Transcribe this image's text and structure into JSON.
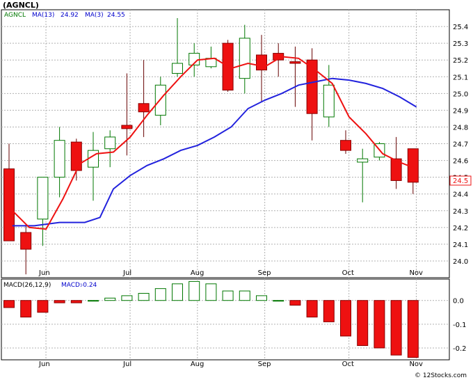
{
  "title": "(AGNCL)",
  "footer": "© 12Stocks.com",
  "colors": {
    "up": "#ffffff",
    "down": "#ee1111",
    "up_border": "#007700",
    "ma13": "#2222dd",
    "ma3": "#ee1111",
    "grid": "#b0b0b0"
  },
  "chart_data": [
    {
      "type": "candlestick",
      "legend": {
        "ticker": "AGNCL",
        "ma13": "MA(13)",
        "ma13_val": "24.92",
        "ma3": "MA(3)",
        "ma3_val": "24.55"
      },
      "ylim": [
        23.9,
        25.5
      ],
      "yticks": [
        "24.0",
        "24.1",
        "24.2",
        "24.3",
        "24.4",
        "24.5",
        "24.6",
        "24.7",
        "24.8",
        "24.9",
        "25.0",
        "25.1",
        "25.2",
        "25.3",
        "25.4"
      ],
      "last_price": "24.5",
      "months": [
        {
          "label": "Jun",
          "at": 1.2
        },
        {
          "label": "Jul",
          "at": 6.2
        },
        {
          "label": "Aug",
          "at": 10.2
        },
        {
          "label": "Sep",
          "at": 14.2
        },
        {
          "label": "Oct",
          "at": 19.2
        },
        {
          "label": "Nov",
          "at": 23.2
        }
      ],
      "candles": [
        {
          "o": 24.55,
          "h": 24.7,
          "l": 24.12,
          "c": 24.12
        },
        {
          "o": 24.17,
          "h": 24.22,
          "l": 23.92,
          "c": 24.07
        },
        {
          "o": 24.25,
          "h": 24.5,
          "l": 24.09,
          "c": 24.5
        },
        {
          "o": 24.5,
          "h": 24.8,
          "l": 24.38,
          "c": 24.72
        },
        {
          "o": 24.71,
          "h": 24.73,
          "l": 24.48,
          "c": 24.54
        },
        {
          "o": 24.56,
          "h": 24.77,
          "l": 24.36,
          "c": 24.66
        },
        {
          "o": 24.67,
          "h": 24.78,
          "l": 24.56,
          "c": 24.74
        },
        {
          "o": 24.81,
          "h": 25.12,
          "l": 24.63,
          "c": 24.79
        },
        {
          "o": 24.94,
          "h": 25.2,
          "l": 24.74,
          "c": 24.89
        },
        {
          "o": 24.87,
          "h": 25.1,
          "l": 24.81,
          "c": 25.05
        },
        {
          "o": 25.12,
          "h": 25.45,
          "l": 25.1,
          "c": 25.18
        },
        {
          "o": 25.17,
          "h": 25.3,
          "l": 25.1,
          "c": 25.24
        },
        {
          "o": 25.16,
          "h": 25.28,
          "l": 25.15,
          "c": 25.21
        },
        {
          "o": 25.3,
          "h": 25.32,
          "l": 25.01,
          "c": 25.02
        },
        {
          "o": 25.09,
          "h": 25.41,
          "l": 25.0,
          "c": 25.33
        },
        {
          "o": 25.23,
          "h": 25.35,
          "l": 24.95,
          "c": 25.14
        },
        {
          "o": 25.24,
          "h": 25.3,
          "l": 25.1,
          "c": 25.2
        },
        {
          "o": 25.19,
          "h": 25.28,
          "l": 24.92,
          "c": 25.18
        },
        {
          "o": 25.2,
          "h": 25.27,
          "l": 24.72,
          "c": 24.88
        },
        {
          "o": 24.86,
          "h": 25.17,
          "l": 24.8,
          "c": 25.05
        },
        {
          "o": 24.72,
          "h": 24.78,
          "l": 24.64,
          "c": 24.66
        },
        {
          "o": 24.59,
          "h": 24.67,
          "l": 24.35,
          "c": 24.61
        },
        {
          "o": 24.62,
          "h": 24.71,
          "l": 24.6,
          "c": 24.7
        },
        {
          "o": 24.61,
          "h": 24.74,
          "l": 24.43,
          "c": 24.48
        },
        {
          "o": 24.67,
          "h": 24.67,
          "l": 24.4,
          "c": 24.47
        }
      ],
      "ma13": [
        [
          0.2,
          24.21
        ],
        [
          1.5,
          24.21
        ],
        [
          3.0,
          24.23
        ],
        [
          4.5,
          24.23
        ],
        [
          5.4,
          24.26
        ],
        [
          6.2,
          24.43
        ],
        [
          7.2,
          24.51
        ],
        [
          8.2,
          24.57
        ],
        [
          9.2,
          24.61
        ],
        [
          10.2,
          24.66
        ],
        [
          11.2,
          24.69
        ],
        [
          12.2,
          24.74
        ],
        [
          13.2,
          24.8
        ],
        [
          14.2,
          24.91
        ],
        [
          15.2,
          24.96
        ],
        [
          16.2,
          25.0
        ],
        [
          17.2,
          25.05
        ],
        [
          18.2,
          25.07
        ],
        [
          19.2,
          25.09
        ],
        [
          20.2,
          25.08
        ],
        [
          21.2,
          25.06
        ],
        [
          22.2,
          25.03
        ],
        [
          23.2,
          24.98
        ],
        [
          24.2,
          24.92
        ]
      ],
      "ma3": [
        [
          0.2,
          24.3
        ],
        [
          1.2,
          24.2
        ],
        [
          2.2,
          24.19
        ],
        [
          3.2,
          24.37
        ],
        [
          4.2,
          24.58
        ],
        [
          5.2,
          24.64
        ],
        [
          6.2,
          24.65
        ],
        [
          7.2,
          24.74
        ],
        [
          8.2,
          24.87
        ],
        [
          9.2,
          24.99
        ],
        [
          10.2,
          25.1
        ],
        [
          11.2,
          25.2
        ],
        [
          12.2,
          25.21
        ],
        [
          13.2,
          25.15
        ],
        [
          14.2,
          25.18
        ],
        [
          15.2,
          25.16
        ],
        [
          16.2,
          25.22
        ],
        [
          17.2,
          25.21
        ],
        [
          18.2,
          25.14
        ],
        [
          19.2,
          25.06
        ],
        [
          20.2,
          24.86
        ],
        [
          21.2,
          24.76
        ],
        [
          22.2,
          24.64
        ],
        [
          23.2,
          24.59
        ],
        [
          24.2,
          24.55
        ]
      ]
    },
    {
      "type": "bar",
      "legend": {
        "name": "MACD(26,12,9)",
        "label": "MACD:",
        "value": "-0.24"
      },
      "ylim": [
        -0.25,
        0.09
      ],
      "yticks": [
        "0.0",
        "-0.1",
        "-0.2"
      ],
      "ytick_values": [
        0.0,
        -0.1,
        -0.2
      ],
      "months": [
        "Jun",
        "Jul",
        "Aug",
        "Sep",
        "Oct",
        "Nov"
      ],
      "values": [
        -0.03,
        -0.07,
        -0.05,
        -0.01,
        -0.01,
        0.0,
        0.01,
        0.02,
        0.03,
        0.05,
        0.07,
        0.08,
        0.07,
        0.04,
        0.04,
        0.02,
        0.0,
        -0.02,
        -0.07,
        -0.09,
        -0.15,
        -0.19,
        -0.2,
        -0.23,
        -0.24
      ]
    }
  ]
}
